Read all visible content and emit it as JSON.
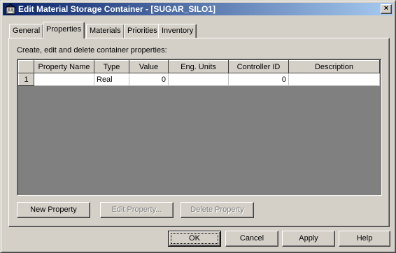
{
  "window": {
    "title": "Edit Material Storage Container - [SUGAR_SILO1]",
    "close_label": "×"
  },
  "tabs": [
    {
      "label": "General",
      "active": false
    },
    {
      "label": "Properties",
      "active": true
    },
    {
      "label": "Materials",
      "active": false
    },
    {
      "label": "Priorities",
      "active": false
    },
    {
      "label": "Inventory",
      "active": false
    }
  ],
  "panel": {
    "description": "Create, edit and delete container properties:"
  },
  "grid": {
    "columns": [
      "Property Name",
      "Type",
      "Value",
      "Eng. Units",
      "Controller ID",
      "Description"
    ],
    "rows": [
      {
        "row_number": "1",
        "property_name": "",
        "type": "Real",
        "value": "0",
        "eng_units": "",
        "controller_id": "0",
        "description": ""
      }
    ]
  },
  "panel_buttons": {
    "new_property": "New Property",
    "edit_property": "Edit Property...",
    "delete_property": "Delete Property"
  },
  "dialog_buttons": {
    "ok": "OK",
    "cancel": "Cancel",
    "apply": "Apply",
    "help": "Help"
  },
  "colors": {
    "face": "#d4d0c8",
    "title_start": "#0a246a",
    "title_end": "#a6caf0"
  }
}
